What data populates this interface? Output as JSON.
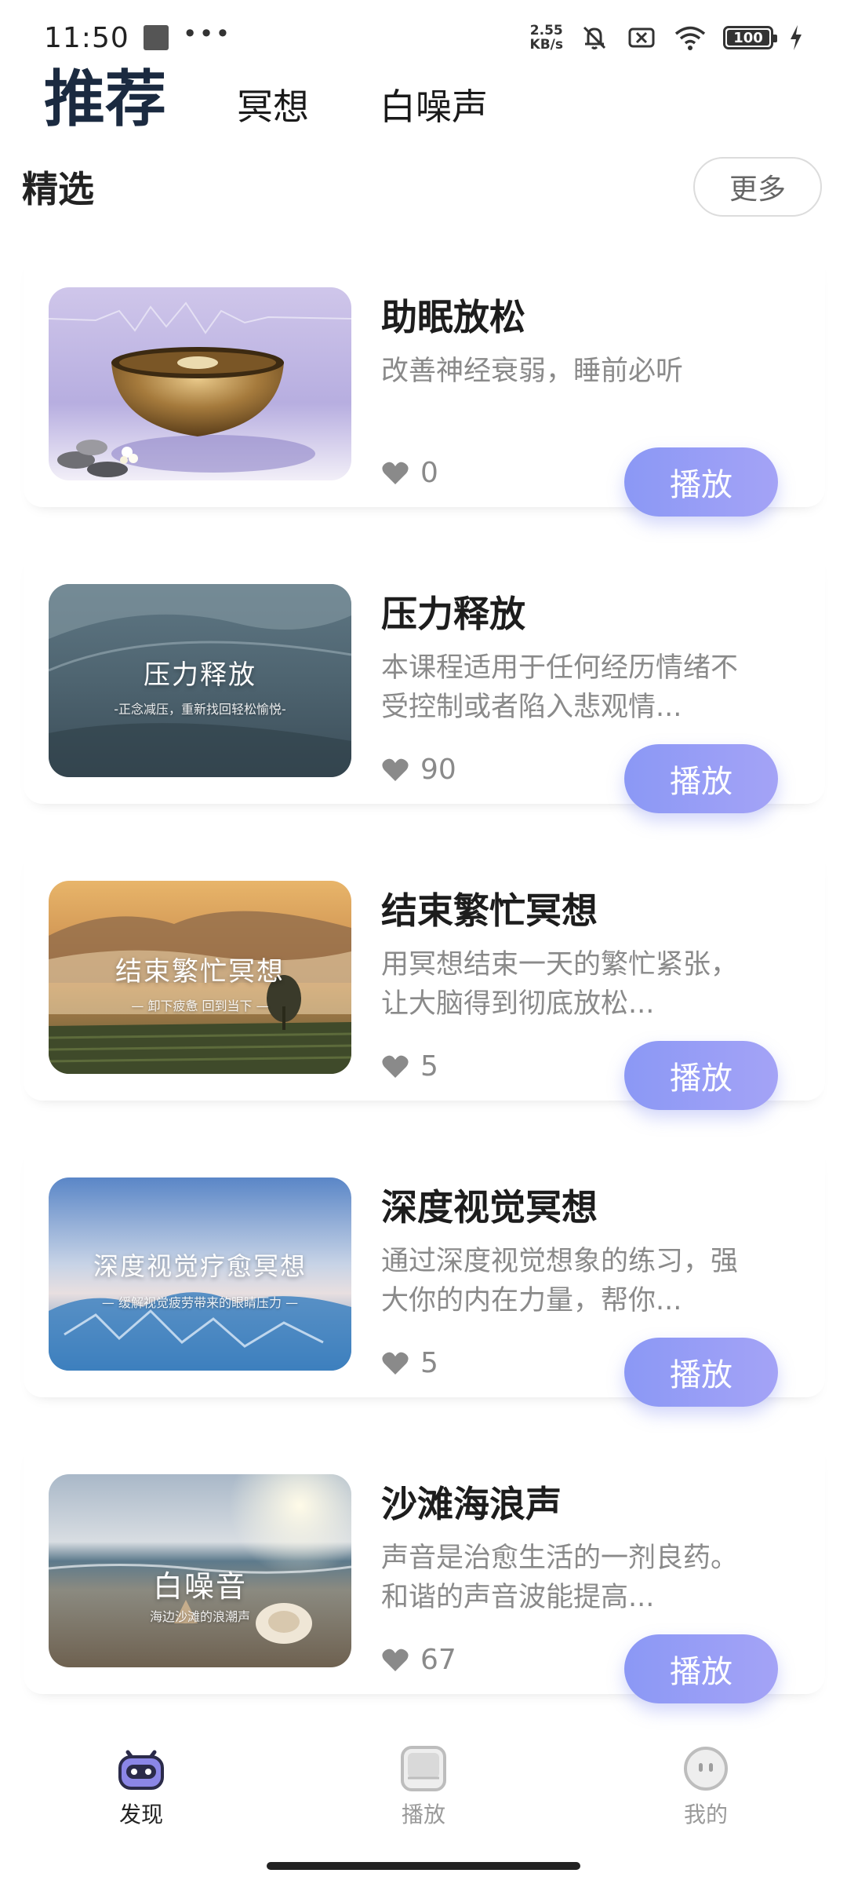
{
  "status_bar": {
    "time": "11:50",
    "dots": "•••",
    "speed_value": "2.55",
    "speed_unit": "KB/s",
    "battery": "100"
  },
  "tabs": [
    {
      "label": "推荐",
      "active": true
    },
    {
      "label": "冥想",
      "active": false
    },
    {
      "label": "白噪声",
      "active": false
    }
  ],
  "section": {
    "title": "精选",
    "more_label": "更多"
  },
  "items": [
    {
      "title": "助眠放松",
      "description": "改善神经衰弱，睡前必听",
      "likes": "0",
      "play_label": "播放",
      "thumb_title": "",
      "thumb_subtitle": "",
      "thumb_theme": "singing-bowl"
    },
    {
      "title": "压力释放",
      "description": "本课程适用于任何经历情绪不受控制或者陷入悲观情...",
      "likes": "90",
      "play_label": "播放",
      "thumb_title": "压力释放",
      "thumb_subtitle": "-正念减压，重新找回轻松愉悦-",
      "thumb_theme": "ocean-wave"
    },
    {
      "title": "结束繁忙冥想",
      "description": "用冥想结束一天的繁忙紧张，让大脑得到彻底放松...",
      "likes": "5",
      "play_label": "播放",
      "thumb_title": "结束繁忙冥想",
      "thumb_subtitle": "— 卸下疲惫 回到当下 —",
      "thumb_theme": "misty-mountain"
    },
    {
      "title": "深度视觉冥想",
      "description": "通过深度视觉想象的练习，强大你的内在力量，帮你...",
      "likes": "5",
      "play_label": "播放",
      "thumb_title": "深度视觉疗愈冥想",
      "thumb_subtitle": "— 缓解视觉疲劳带来的眼睛压力 —",
      "thumb_theme": "ice-sea"
    },
    {
      "title": "沙滩海浪声",
      "description": "声音是治愈生活的一剂良药。和谐的声音波能提高...",
      "likes": "67",
      "play_label": "播放",
      "thumb_title": "白噪音",
      "thumb_subtitle": "海边沙滩的浪潮声",
      "thumb_theme": "beach-sunset"
    }
  ],
  "bottom_nav": [
    {
      "label": "发现",
      "icon": "robot-icon",
      "active": true
    },
    {
      "label": "播放",
      "icon": "player-icon",
      "active": false
    },
    {
      "label": "我的",
      "icon": "profile-face-icon",
      "active": false
    }
  ],
  "colors": {
    "accent": "#8b98f5",
    "accent_end": "#a4a3f6",
    "tab_underline": "#8fb6e8",
    "muted_text": "#8a8a8a"
  }
}
